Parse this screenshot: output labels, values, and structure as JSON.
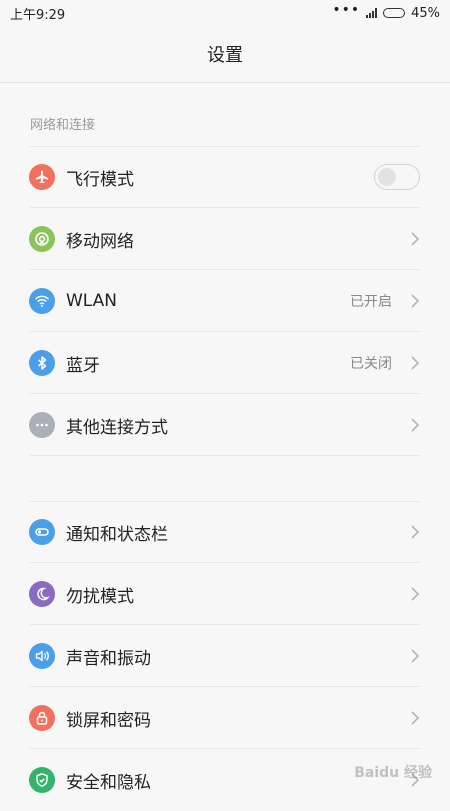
{
  "status_bar": {
    "time": "上午9:29",
    "battery_percent": "45%",
    "battery_level": 0.45
  },
  "header": {
    "title": "设置"
  },
  "section": {
    "title": "网络和连接"
  },
  "items": [
    {
      "label": "飞行模式",
      "icon": "airplane-icon",
      "color": "#f2705e",
      "control": "toggle",
      "toggle_on": false
    },
    {
      "label": "移动网络",
      "icon": "mobile-network-icon",
      "color": "#8dc35b",
      "control": "chevron"
    },
    {
      "label": "WLAN",
      "icon": "wifi-icon",
      "color": "#4a9fe8",
      "value": "已开启",
      "control": "chevron"
    },
    {
      "label": "蓝牙",
      "icon": "bluetooth-icon",
      "color": "#4a9fe8",
      "value": "已关闭",
      "control": "chevron"
    },
    {
      "label": "其他连接方式",
      "icon": "more-dots-icon",
      "color": "#a9b0b9",
      "control": "chevron"
    },
    {
      "label": "通知和状态栏",
      "icon": "notification-toggle-icon",
      "color": "#4a9fe8",
      "control": "chevron"
    },
    {
      "label": "勿扰模式",
      "icon": "moon-icon",
      "color": "#8a6bc2",
      "control": "chevron"
    },
    {
      "label": "声音和振动",
      "icon": "speaker-icon",
      "color": "#4a9fe8",
      "control": "chevron"
    },
    {
      "label": "锁屏和密码",
      "icon": "lock-icon",
      "color": "#f2705e",
      "control": "chevron"
    },
    {
      "label": "安全和隐私",
      "icon": "shield-icon",
      "color": "#33b36b",
      "control": "chevron"
    }
  ],
  "watermark": "Baidu 经验"
}
